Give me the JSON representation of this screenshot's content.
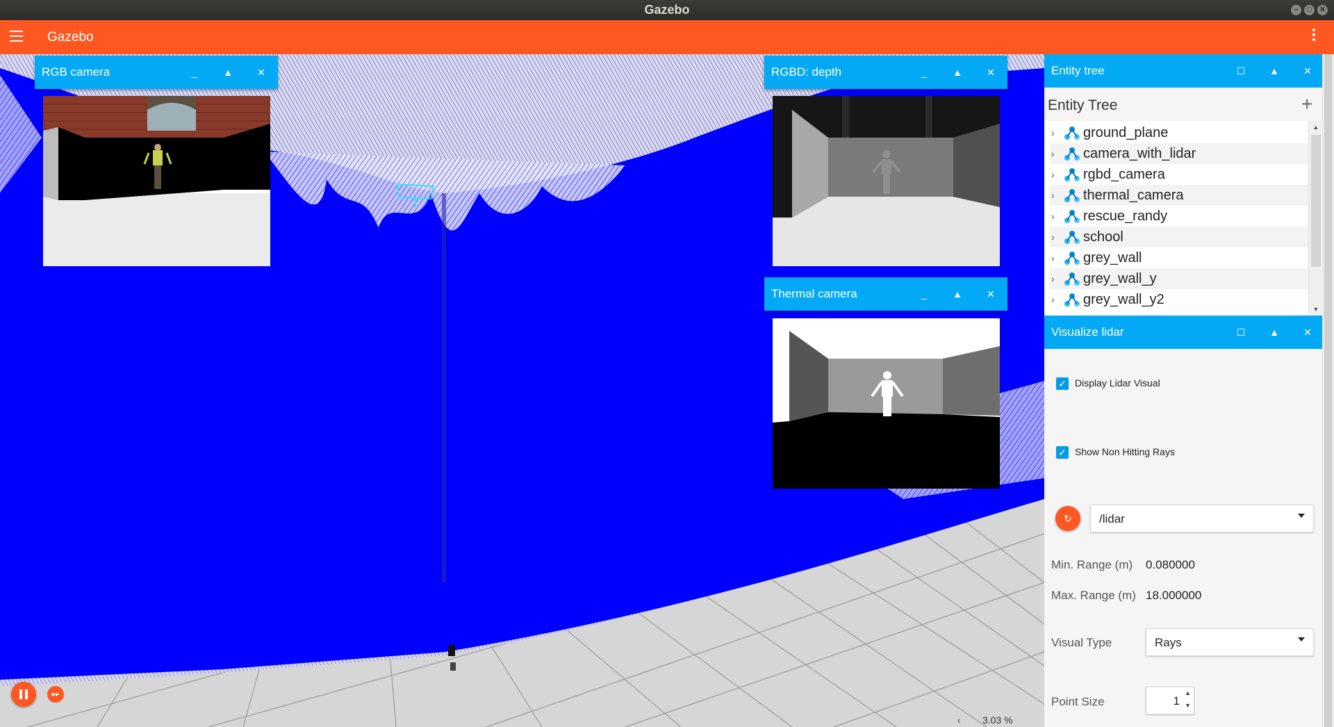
{
  "os": {
    "window_title": "Gazebo"
  },
  "header": {
    "title": "Gazebo"
  },
  "panels": {
    "rgb_camera": {
      "title": "RGB camera"
    },
    "rgbd_depth": {
      "title": "RGBD: depth"
    },
    "thermal_camera": {
      "title": "Thermal camera"
    }
  },
  "entity_tree": {
    "panel_title": "Entity tree",
    "heading": "Entity Tree",
    "items": [
      "ground_plane",
      "camera_with_lidar",
      "rgbd_camera",
      "thermal_camera",
      "rescue_randy",
      "school",
      "grey_wall",
      "grey_wall_y",
      "grey_wall_y2"
    ]
  },
  "visualize_lidar": {
    "panel_title": "Visualize lidar",
    "display_lidar_label": "Display Lidar Visual",
    "display_lidar_checked": true,
    "show_non_hitting_label": "Show Non Hitting Rays",
    "show_non_hitting_checked": true,
    "topic": "/lidar",
    "min_range_label": "Min. Range (m)",
    "min_range_value": "0.080000",
    "max_range_label": "Max. Range (m)",
    "max_range_value": "18.000000",
    "visual_type_label": "Visual Type",
    "visual_type_value": "Rays",
    "point_size_label": "Point Size",
    "point_size_value": "1"
  },
  "status": {
    "rtf": "3.03 %",
    "left_arrow": "‹"
  },
  "colors": {
    "header": "#ff5722",
    "panel_bar": "#03a9f4",
    "lidar": "#0000ff"
  }
}
